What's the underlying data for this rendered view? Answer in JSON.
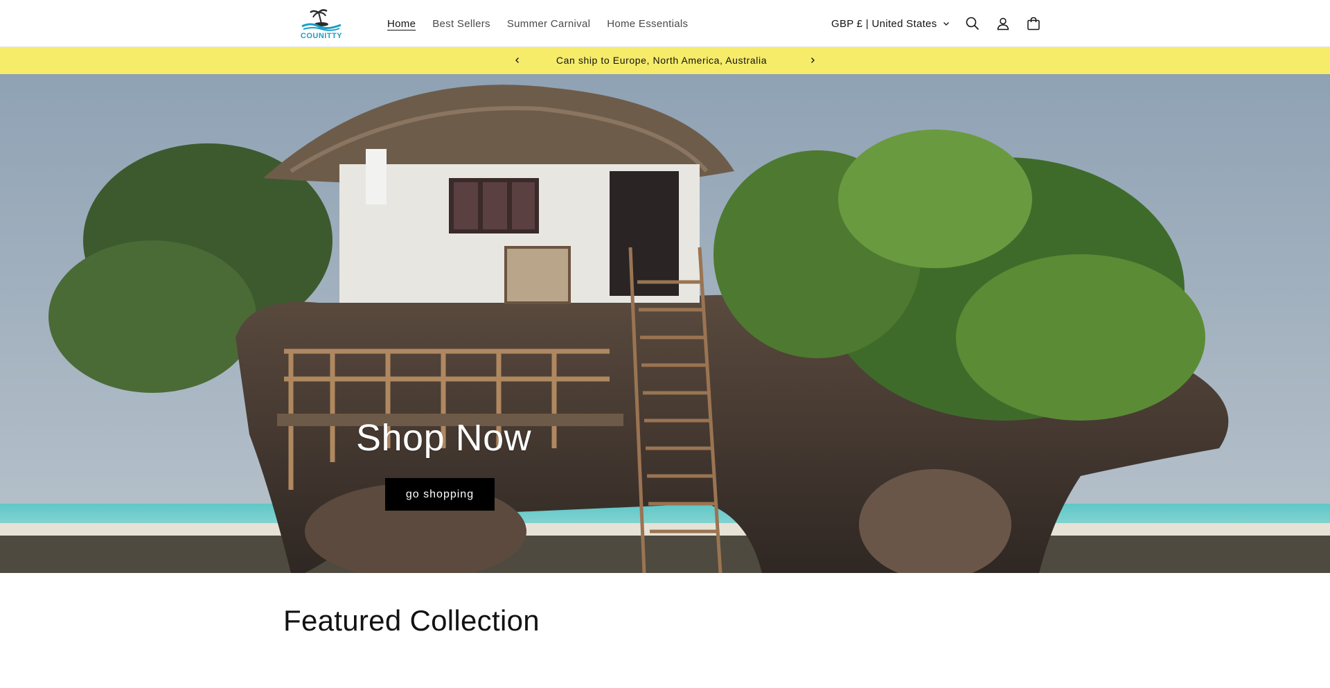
{
  "brand": {
    "logo_text": "COUNITTY",
    "accent_color": "#1a9fc8"
  },
  "nav": {
    "items": [
      {
        "label": "Home",
        "active": true
      },
      {
        "label": "Best Sellers",
        "active": false
      },
      {
        "label": "Summer Carnival",
        "active": false
      },
      {
        "label": "Home Essentials",
        "active": false
      }
    ]
  },
  "header": {
    "country_selector": "GBP £ | United States",
    "icons": [
      "search-icon",
      "account-icon",
      "cart-icon"
    ]
  },
  "announcement": {
    "text": "Can ship to Europe, North America, Australia",
    "background_color": "#f6ec6a"
  },
  "hero": {
    "title": "Shop Now",
    "button_label": "go shopping"
  },
  "featured": {
    "heading": "Featured Collection"
  }
}
